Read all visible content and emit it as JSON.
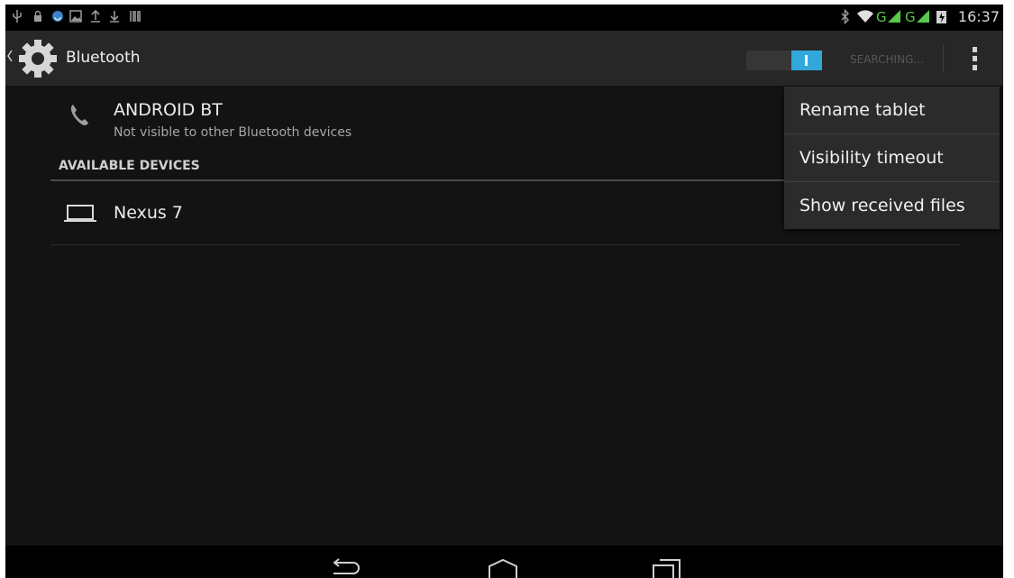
{
  "status_bar": {
    "left_icons": [
      "usb-icon",
      "lock-icon",
      "sync-icon",
      "image-icon",
      "upload-icon",
      "download-icon",
      "barcode-icon"
    ],
    "right_icons": [
      "bluetooth-icon",
      "wifi-icon",
      "signal-icon",
      "signal-icon",
      "battery-icon"
    ],
    "network_labels": [
      "G",
      "G"
    ],
    "time": "16:37"
  },
  "action_bar": {
    "title": "Bluetooth",
    "toggle_on": true,
    "toggle_color": "#32a8da",
    "searching_label": "SEARCHING..."
  },
  "bluetooth": {
    "device_name": "ANDROID BT",
    "visibility": "Not visible to other Bluetooth devices",
    "available_header": "AVAILABLE DEVICES",
    "devices": [
      {
        "name": "Nexus 7",
        "icon": "laptop-icon"
      }
    ]
  },
  "overflow_menu": {
    "items": [
      "Rename tablet",
      "Visibility timeout",
      "Show received files"
    ]
  },
  "nav_bar": {
    "buttons": [
      "back-icon",
      "home-icon",
      "recents-icon"
    ]
  }
}
